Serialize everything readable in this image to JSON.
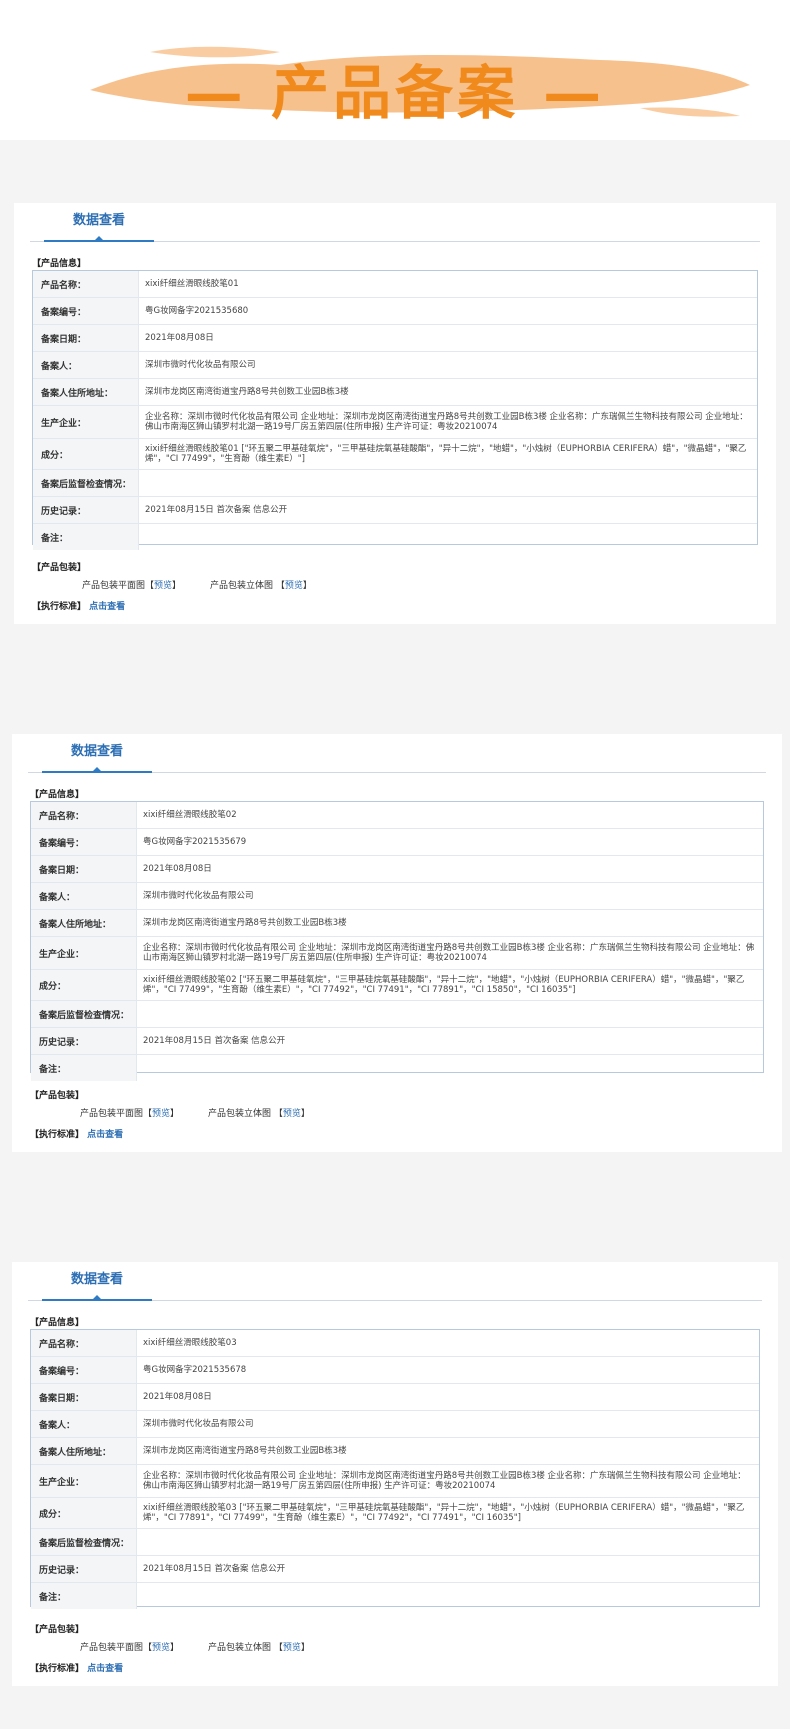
{
  "banner": {
    "title": "— 产品备案 —"
  },
  "labels": {
    "tab": "数据查看",
    "info_section": "【产品信息】",
    "name": "产品名称：",
    "code": "备案编号：",
    "date": "备案日期：",
    "filer": "备案人：",
    "address": "备案人住所地址：",
    "maker": "生产企业：",
    "ingredients": "成分：",
    "post": "备案后监督检查情况：",
    "history": "历史记录：",
    "note": "备注：",
    "pkg_section": "【产品包装】",
    "pkg_flat": "产品包装平面图【",
    "pkg_3d": "产品包装立体图 【",
    "preview": "预览",
    "bracket_close": "】",
    "std_section": "【执行标准】",
    "std_link": "点击查看"
  },
  "records": [
    {
      "name": "xixi纤细丝滑眼线胶笔01",
      "code": "粤G妆网备字2021535680",
      "date": "2021年08月08日",
      "filer": "深圳市微时代化妆品有限公司",
      "address": "深圳市龙岗区南湾街道宝丹路8号共创数工业园B栋3楼",
      "maker": "企业名称：深圳市微时代化妆品有限公司 企业地址：深圳市龙岗区南湾街道宝丹路8号共创数工业园B栋3楼 企业名称：广东瑞佩兰生物科技有限公司 企业地址：佛山市南海区狮山镇罗村北湖一路19号厂房五第四层(住所申报) 生产许可证：粤妆20210074",
      "ingredients": "xixi纤细丝滑眼线胶笔01 [\"环五聚二甲基硅氧烷\"，\"三甲基硅烷氧基硅酸酯\"，\"异十二烷\"，\"地蜡\"，\"小烛树（EUPHORBIA CERIFERA）蜡\"，\"微晶蜡\"，\"聚乙烯\"，\"CI 77499\"，\"生育酚（维生素E）\"]",
      "post": "",
      "history": "2021年08月15日 首次备案 信息公开",
      "note": ""
    },
    {
      "name": "xixi纤细丝滑眼线胶笔02",
      "code": "粤G妆网备字2021535679",
      "date": "2021年08月08日",
      "filer": "深圳市微时代化妆品有限公司",
      "address": "深圳市龙岗区南湾街道宝丹路8号共创数工业园B栋3楼",
      "maker": "企业名称：深圳市微时代化妆品有限公司 企业地址：深圳市龙岗区南湾街道宝丹路8号共创数工业园B栋3楼 企业名称：广东瑞佩兰生物科技有限公司 企业地址：佛山市南海区狮山镇罗村北湖一路19号厂房五第四层(住所申报) 生产许可证：粤妆20210074",
      "ingredients": "xixi纤细丝滑眼线胶笔02 [\"环五聚二甲基硅氧烷\"，\"三甲基硅烷氧基硅酸酯\"，\"异十二烷\"，\"地蜡\"，\"小烛树（EUPHORBIA CERIFERA）蜡\"，\"微晶蜡\"，\"聚乙烯\"，\"CI 77499\"，\"生育酚（维生素E）\"，\"CI 77492\"，\"CI 77491\"，\"CI 77891\"，\"CI 15850\"，\"CI 16035\"]",
      "post": "",
      "history": "2021年08月15日 首次备案 信息公开",
      "note": ""
    },
    {
      "name": "xixi纤细丝滑眼线胶笔03",
      "code": "粤G妆网备字2021535678",
      "date": "2021年08月08日",
      "filer": "深圳市微时代化妆品有限公司",
      "address": "深圳市龙岗区南湾街道宝丹路8号共创数工业园B栋3楼",
      "maker": "企业名称：深圳市微时代化妆品有限公司 企业地址：深圳市龙岗区南湾街道宝丹路8号共创数工业园B栋3楼 企业名称：广东瑞佩兰生物科技有限公司 企业地址：佛山市南海区狮山镇罗村北湖一路19号厂房五第四层(住所申报) 生产许可证：粤妆20210074",
      "ingredients": "xixi纤细丝滑眼线胶笔03 [\"环五聚二甲基硅氧烷\"，\"三甲基硅烷氧基硅酸酯\"，\"异十二烷\"，\"地蜡\"，\"小烛树（EUPHORBIA CERIFERA）蜡\"，\"微晶蜡\"，\"聚乙烯\"，\"CI 77891\"，\"CI 77499\"，\"生育酚（维生素E）\"，\"CI 77492\"，\"CI 77491\"，\"CI 16035\"]",
      "post": "",
      "history": "2021年08月15日 首次备案 信息公开",
      "note": ""
    }
  ],
  "colors": {
    "accent": "#2e6fb4",
    "banner": "#f08a1c",
    "brush": "#f6b679"
  }
}
